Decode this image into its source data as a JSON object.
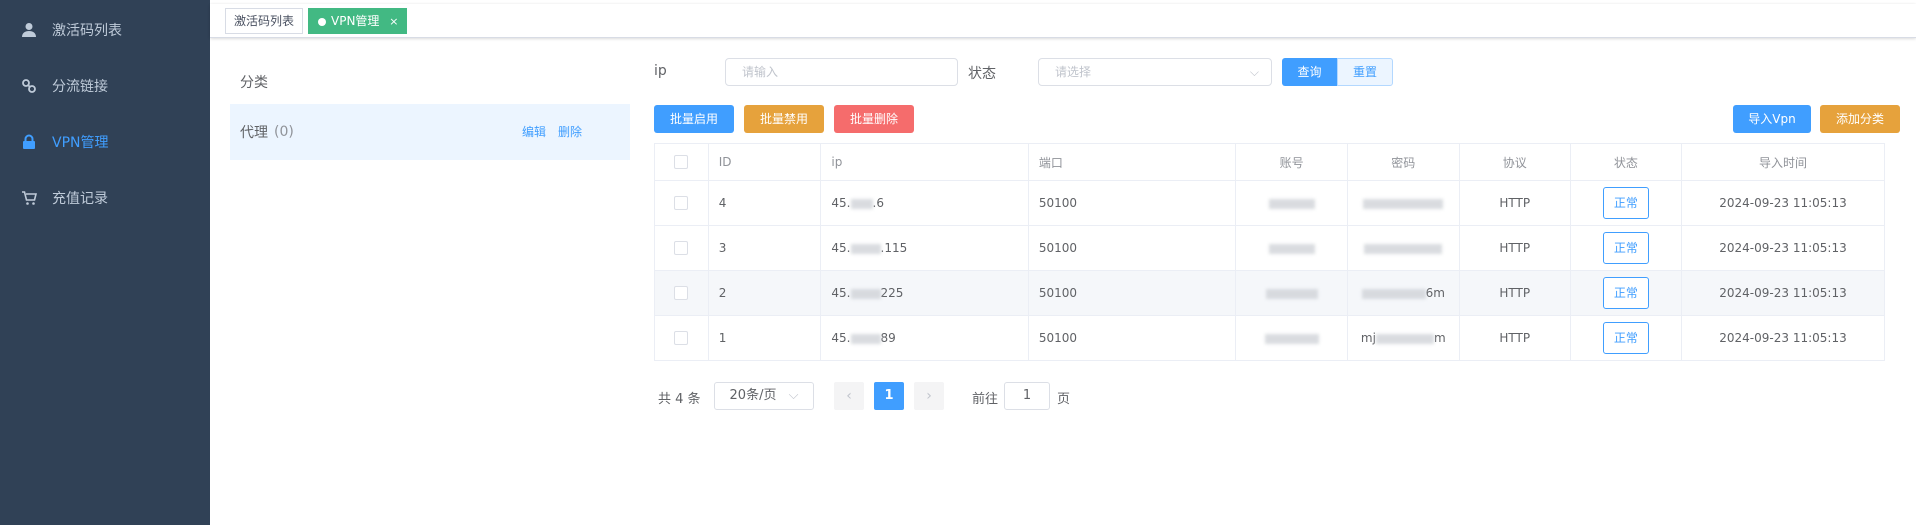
{
  "sidebar": {
    "items": [
      {
        "label": "激活码列表",
        "icon": "user-icon"
      },
      {
        "label": "分流链接",
        "icon": "link-icon"
      },
      {
        "label": "VPN管理",
        "icon": "lock-icon",
        "active": true
      },
      {
        "label": "充值记录",
        "icon": "cart-icon"
      }
    ]
  },
  "tags": [
    {
      "label": "激活码列表"
    },
    {
      "label": "VPN管理",
      "close": "×",
      "active": true
    }
  ],
  "category": {
    "title": "分类",
    "item": {
      "name": "代理",
      "count": "(0)",
      "edit": "编辑",
      "delete": "删除"
    }
  },
  "filter": {
    "ip_label": "ip",
    "ip_placeholder": "请输入",
    "status_label": "状态",
    "status_placeholder": "请选择",
    "query": "查询",
    "reset": "重置"
  },
  "toolbar": {
    "enable": "批量启用",
    "disable": "批量禁用",
    "delete": "批量删除",
    "import": "导入Vpn",
    "add_category": "添加分类"
  },
  "table": {
    "headers": [
      "ID",
      "ip",
      "端口",
      "账号",
      "密码",
      "协议",
      "状态",
      "导入时间"
    ],
    "rows": [
      {
        "id": "4",
        "ip_pre": "45.",
        "ip_post": ".6",
        "port": "50100",
        "account": "",
        "password_pre": "",
        "password_post": "",
        "protocol": "HTTP",
        "status": "正常",
        "time": "2024-09-23 11:05:13"
      },
      {
        "id": "3",
        "ip_pre": "45.",
        "ip_post": ".115",
        "port": "50100",
        "account": "",
        "password_pre": "",
        "password_post": "",
        "protocol": "HTTP",
        "status": "正常",
        "time": "2024-09-23 11:05:13"
      },
      {
        "id": "2",
        "ip_pre": "45.",
        "ip_post": "225",
        "port": "50100",
        "account": "",
        "password_pre": "",
        "password_post": "6m",
        "protocol": "HTTP",
        "status": "正常",
        "time": "2024-09-23 11:05:13"
      },
      {
        "id": "1",
        "ip_pre": "45.",
        "ip_post": "89",
        "port": "50100",
        "account": "",
        "password_pre": "mj",
        "password_post": "m",
        "protocol": "HTTP",
        "status": "正常",
        "time": "2024-09-23 11:05:13"
      }
    ]
  },
  "pagination": {
    "total": "共 4 条",
    "page_size": "20条/页",
    "current": "1",
    "goto_label": "前往",
    "goto_value": "1",
    "page_suffix": "页"
  }
}
